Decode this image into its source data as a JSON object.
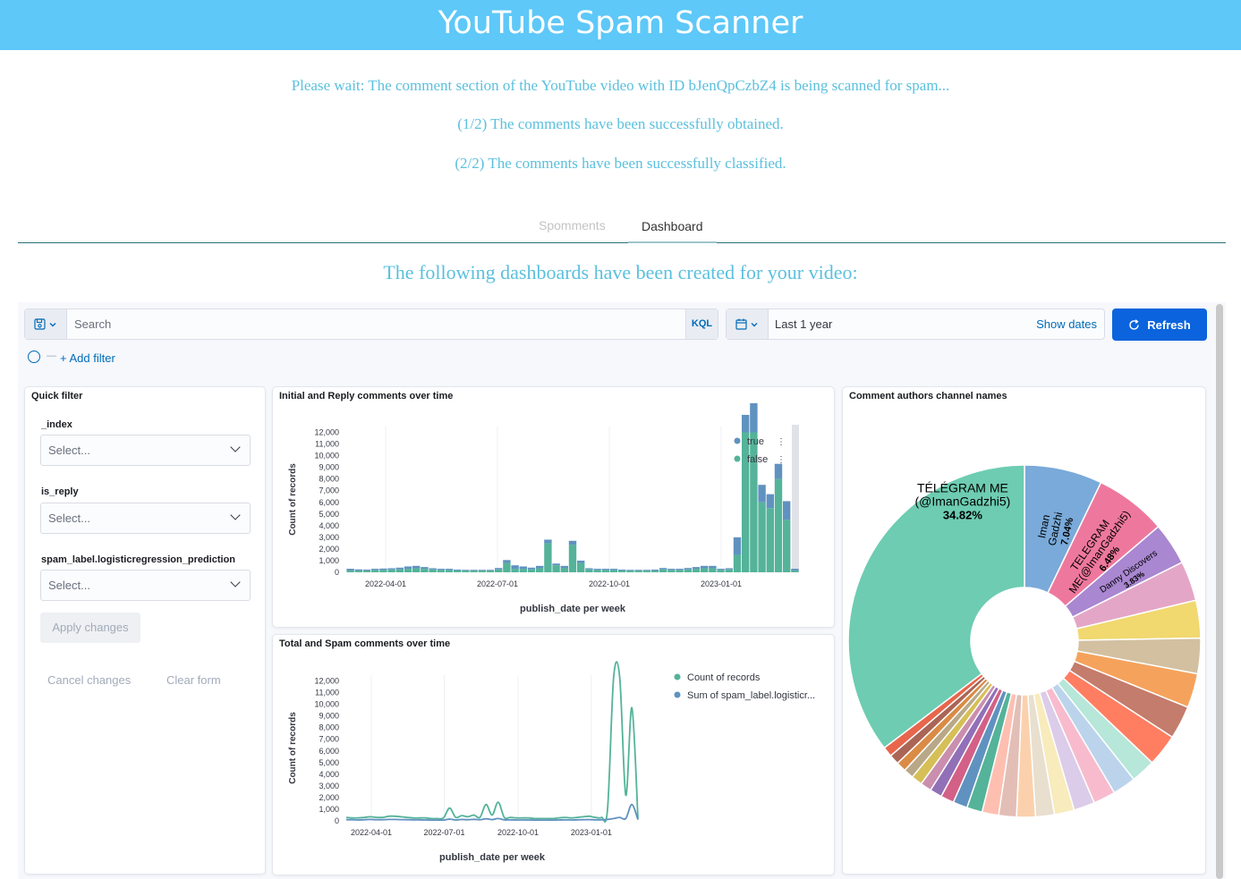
{
  "app": {
    "title": "YouTube Spam Scanner",
    "status_lines": [
      "Please wait: The comment section of the YouTube video with ID bJenQpCzbZ4 is being scanned for spam...",
      "(1/2) The comments have been successfully obtained.",
      "(2/2) The comments have been successfully classified."
    ],
    "tabs": [
      "Spomments",
      "Dashboard"
    ],
    "active_tab": "Dashboard",
    "subtitle": "The following dashboards have been created for your video:"
  },
  "query_bar": {
    "search_placeholder": "Search",
    "language": "KQL",
    "date_range": "Last 1 year",
    "show_dates": "Show dates",
    "refresh": "Refresh",
    "add_filter": "+ Add filter",
    "filter_dash": "—",
    "accent": "#0b64dd"
  },
  "quick_filter": {
    "title": "Quick filter",
    "fields": [
      {
        "label": "_index",
        "placeholder": "Select..."
      },
      {
        "label": "is_reply",
        "placeholder": "Select..."
      },
      {
        "label": "spam_label.logisticregression_prediction",
        "placeholder": "Select..."
      }
    ],
    "apply": "Apply changes",
    "cancel": "Cancel changes",
    "clear": "Clear form"
  },
  "chart_data": [
    {
      "type": "bar",
      "title": "Initial and Reply comments over time",
      "xlabel": "publish_date per week",
      "ylabel": "Count of records",
      "ylim": [
        0,
        12500
      ],
      "yticks": [
        "0",
        "1,000",
        "2,000",
        "3,000",
        "4,000",
        "5,000",
        "6,000",
        "7,000",
        "8,000",
        "9,000",
        "10,000",
        "11,000",
        "12,000"
      ],
      "xticks": [
        "2022-04-01",
        "2022-07-01",
        "2022-10-01",
        "2023-01-01"
      ],
      "stacked": true,
      "legend": "top-right",
      "series": [
        {
          "name": "true",
          "color": "#6092c0",
          "values": [
            150,
            100,
            80,
            100,
            120,
            100,
            150,
            200,
            200,
            150,
            100,
            100,
            100,
            80,
            60,
            60,
            60,
            60,
            120,
            250,
            300,
            200,
            150,
            200,
            300,
            150,
            200,
            350,
            200,
            100,
            100,
            100,
            100,
            80,
            60,
            60,
            60,
            80,
            120,
            100,
            100,
            120,
            150,
            200,
            200,
            100,
            100,
            1500,
            1500,
            2500,
            1500,
            1200,
            1300,
            1600,
            150
          ]
        },
        {
          "name": "false",
          "color": "#54b399",
          "values": [
            150,
            150,
            150,
            200,
            200,
            250,
            250,
            300,
            350,
            300,
            250,
            200,
            200,
            150,
            150,
            150,
            150,
            150,
            250,
            800,
            300,
            300,
            250,
            350,
            2500,
            600,
            350,
            2350,
            800,
            250,
            200,
            200,
            200,
            150,
            150,
            150,
            150,
            150,
            250,
            200,
            200,
            250,
            300,
            350,
            350,
            200,
            250,
            1500,
            12000,
            12000,
            6000,
            5500,
            8000,
            4500,
            150
          ]
        }
      ]
    },
    {
      "type": "line",
      "title": "Total and Spam comments over time",
      "xlabel": "publish_date per week",
      "ylabel": "Count of records",
      "ylim": [
        0,
        12500
      ],
      "yticks": [
        "0",
        "1,000",
        "2,000",
        "3,000",
        "4,000",
        "5,000",
        "6,000",
        "7,000",
        "8,000",
        "9,000",
        "10,000",
        "11,000",
        "12,000"
      ],
      "xticks": [
        "2022-04-01",
        "2022-07-01",
        "2022-10-01",
        "2023-01-01"
      ],
      "legend": "top-right",
      "series": [
        {
          "name": "Count of records",
          "color": "#54b399",
          "values": [
            300,
            250,
            250,
            300,
            350,
            300,
            300,
            400,
            400,
            350,
            300,
            250,
            250,
            250,
            200,
            200,
            250,
            1100,
            300,
            450,
            350,
            500,
            300,
            1400,
            500,
            1600,
            300,
            300,
            250,
            250,
            250,
            200,
            200,
            200,
            200,
            250,
            300,
            250,
            300,
            350,
            400,
            300,
            300,
            1000,
            12300,
            12300,
            2200,
            9700,
            200
          ]
        },
        {
          "name": "Sum of spam_label.logisticr...",
          "color": "#6092c0",
          "values": [
            100,
            100,
            80,
            100,
            120,
            100,
            100,
            120,
            120,
            110,
            100,
            90,
            90,
            80,
            70,
            70,
            70,
            150,
            80,
            120,
            100,
            130,
            100,
            180,
            110,
            200,
            90,
            90,
            80,
            80,
            80,
            70,
            70,
            70,
            70,
            80,
            90,
            80,
            90,
            100,
            110,
            90,
            90,
            120,
            200,
            300,
            200,
            1400,
            100
          ]
        }
      ]
    },
    {
      "type": "pie",
      "title": "Comment authors channel names",
      "donut": true,
      "slices": [
        {
          "label": "TÉLÉGRAM ME (@ImanGadzhi5)",
          "percent": 34.82,
          "color": "#6dccb1"
        },
        {
          "label": "Iman Gadzhi",
          "percent": 7.04,
          "color": "#79aad9"
        },
        {
          "label": "TELEGRAM ME(@ImanGadzhi5)",
          "percent": 6.48,
          "color": "#ee789d"
        },
        {
          "label": "Danny Discovers",
          "percent": 3.83,
          "color": "#a987d1"
        },
        {
          "label": "",
          "percent": 3.6,
          "color": "#e4a6c7"
        },
        {
          "label": "",
          "percent": 3.4,
          "color": "#f1d86f"
        },
        {
          "label": "",
          "percent": 3.2,
          "color": "#d2c0a0"
        },
        {
          "label": "",
          "percent": 3.1,
          "color": "#f5a35c"
        },
        {
          "label": "",
          "percent": 3.0,
          "color": "#c47c6c"
        },
        {
          "label": "",
          "percent": 2.9,
          "color": "#ff7e62"
        },
        {
          "label": "",
          "percent": 2.2,
          "color": "#b6e7d9"
        },
        {
          "label": "",
          "percent": 2.1,
          "color": "#bbd4ec"
        },
        {
          "label": "",
          "percent": 2.0,
          "color": "#f8bbce"
        },
        {
          "label": "",
          "percent": 1.9,
          "color": "#dbcce9"
        },
        {
          "label": "",
          "percent": 1.8,
          "color": "#f8ebbc"
        },
        {
          "label": "",
          "percent": 1.7,
          "color": "#e8dfcf"
        },
        {
          "label": "",
          "percent": 1.7,
          "color": "#fbd1ad"
        },
        {
          "label": "",
          "percent": 1.6,
          "color": "#e2beb6"
        },
        {
          "label": "",
          "percent": 1.5,
          "color": "#ffbfb0"
        },
        {
          "label": "",
          "percent": 1.4,
          "color": "#54b399"
        },
        {
          "label": "",
          "percent": 1.3,
          "color": "#6092c0"
        },
        {
          "label": "",
          "percent": 1.2,
          "color": "#d36086"
        },
        {
          "label": "",
          "percent": 1.1,
          "color": "#9170b8"
        },
        {
          "label": "",
          "percent": 1.0,
          "color": "#ca8eae"
        },
        {
          "label": "",
          "percent": 1.0,
          "color": "#d6bf57"
        },
        {
          "label": "",
          "percent": 0.9,
          "color": "#b9a888"
        },
        {
          "label": "",
          "percent": 0.9,
          "color": "#da8b45"
        },
        {
          "label": "",
          "percent": 0.9,
          "color": "#aa6556"
        },
        {
          "label": "",
          "percent": 0.9,
          "color": "#e7664c"
        }
      ]
    }
  ]
}
